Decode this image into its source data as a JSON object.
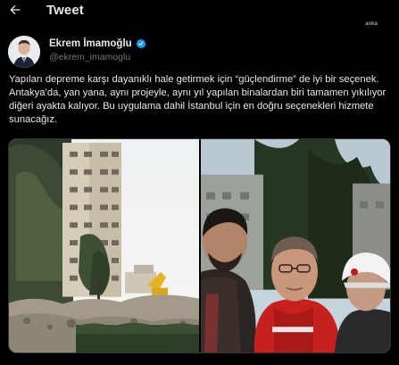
{
  "header": {
    "title": "Tweet",
    "back_icon": "arrow-left-icon"
  },
  "watermark": "anka",
  "author": {
    "name": "Ekrem İmamoğlu",
    "handle": "@ekrem_imamoglu",
    "verified": true,
    "verified_color": "#1d9bf0"
  },
  "tweet": {
    "text": "Yapıları depreme karşı dayanıklı hale getirmek için “güçlendirme” de iyi bir seçenek. Antakya’da, yan yana, aynı projeyle, aynı yıl yapılan binalardan biri tamamen yıkılıyor diğeri ayakta kalıyor. Bu uygulama dahil İstanbul için en doğru seçenekleri hizmete sunacağız."
  },
  "media": {
    "count": 2
  },
  "colors": {
    "background": "#000000",
    "text": "#e7e9ea",
    "secondary_text": "#71767b",
    "accent": "#1d9bf0"
  }
}
